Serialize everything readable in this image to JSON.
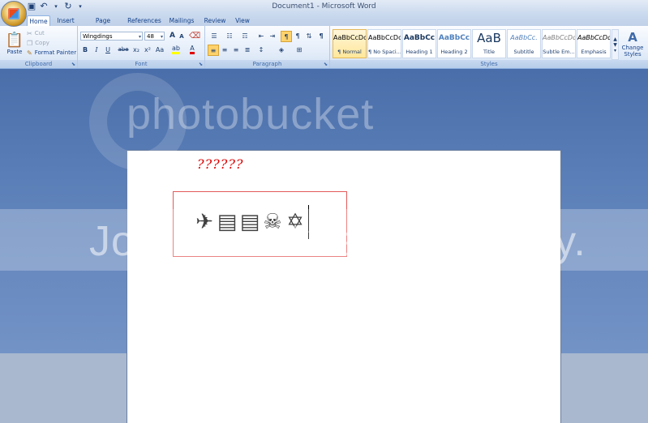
{
  "window": {
    "title": "Document1 - Microsoft Word"
  },
  "quick_access": [
    "save-icon",
    "undo-icon",
    "redo-icon",
    "customize-icon"
  ],
  "tabs": [
    "Home",
    "Insert",
    "Page Layout",
    "References",
    "Mailings",
    "Review",
    "View"
  ],
  "active_tab": "Home",
  "clipboard": {
    "label": "Clipboard",
    "paste": "Paste",
    "cut": "Cut",
    "copy": "Copy",
    "format_painter": "Format Painter"
  },
  "font": {
    "label": "Font",
    "name": "Wingdings",
    "size": "48",
    "grow": "A",
    "shrink": "A",
    "bold": "B",
    "italic": "I",
    "underline": "U",
    "strike": "abe",
    "subscript": "x₂",
    "superscript": "x²",
    "change_case": "Aa",
    "font_color": "A"
  },
  "paragraph": {
    "label": "Paragraph"
  },
  "styles": {
    "label": "Styles",
    "items": [
      {
        "preview": "AaBbCcDc",
        "name": "¶ Normal"
      },
      {
        "preview": "AaBbCcDc",
        "name": "¶ No Spaci..."
      },
      {
        "preview": "AaBbCc",
        "name": "Heading 1"
      },
      {
        "preview": "AaBbCc",
        "name": "Heading 2"
      },
      {
        "preview": "AaB",
        "name": "Title"
      },
      {
        "preview": "AaBbCc.",
        "name": "Subtitle"
      },
      {
        "preview": "AaBbCcDc",
        "name": "Subtle Em..."
      },
      {
        "preview": "AaBbCcDc",
        "name": "Emphasis"
      }
    ],
    "change_styles": "Change Styles"
  },
  "document": {
    "heading_text": "??????",
    "symbols": [
      "✈",
      "▤",
      "▤",
      "☠",
      "✡"
    ]
  },
  "watermark": {
    "brand": "photobucket",
    "slogan": "Join free. Share privately."
  },
  "colors": {
    "red_text": "#e00000",
    "box_border": "#e45a5a"
  }
}
